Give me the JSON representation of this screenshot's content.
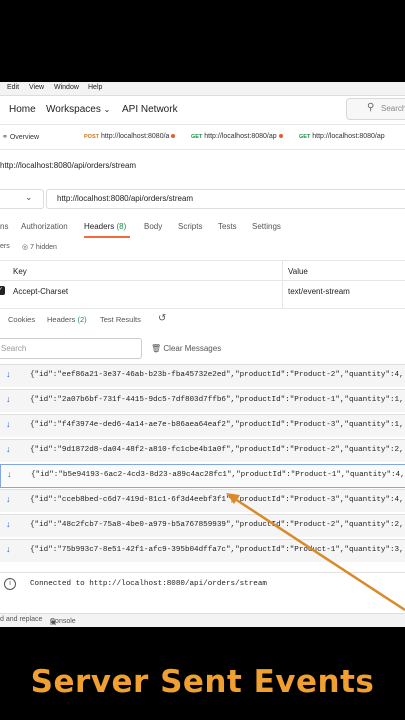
{
  "menubar": {
    "edit": "Edit",
    "view": "View",
    "window": "Window",
    "help": "Help"
  },
  "topnav": {
    "home": "Home",
    "workspaces": "Workspaces",
    "api_network": "API Network",
    "search_placeholder": "Search"
  },
  "tabs": [
    {
      "method": "",
      "label": "Overview"
    },
    {
      "method": "POST",
      "label": "http://localhost:8080/a"
    },
    {
      "method": "GET",
      "label": "http://localhost:8080/ap"
    },
    {
      "method": "GET",
      "label": "http://localhost:8080/ap"
    }
  ],
  "request": {
    "title": "http://localhost:8080/api/orders/stream",
    "url": "http://localhost:8080/api/orders/stream"
  },
  "request_tabs": {
    "params": "ns",
    "authorization": "Authorization",
    "headers": "Headers",
    "headers_count": "(8)",
    "body": "Body",
    "scripts": "Scripts",
    "tests": "Tests",
    "settings": "Settings"
  },
  "headers_section": {
    "label": "ers",
    "hidden": "7 hidden"
  },
  "header_table": {
    "col_key": "Key",
    "col_value": "Value",
    "rows": [
      {
        "key": "Accept-Charset",
        "value": "text/event-stream"
      }
    ]
  },
  "response_tabs": {
    "cookies": "Cookies",
    "headers": "Headers",
    "headers_count": "(2)",
    "test_results": "Test Results"
  },
  "messages_toolbar": {
    "search_placeholder": "Search",
    "clear": "Clear Messages"
  },
  "messages": [
    "{\"id\":\"eef86a21-3e37-46ab-b23b-fba45732e2ed\",\"productId\":\"Product-2\",\"quantity\":4,",
    "{\"id\":\"2a07b6bf-731f-4415-9dc5-7df803d7ffb6\",\"productId\":\"Product-1\",\"quantity\":1,",
    "{\"id\":\"f4f3974e-ded6-4a14-ae7e-b86aea64eaf2\",\"productId\":\"Product-3\",\"quantity\":1,",
    "{\"id\":\"9d1872d8-da04-48f2-a810-fc1cbe4b1a0f\",\"productId\":\"Product-2\",\"quantity\":2,",
    "{\"id\":\"b5e94193-6ac2-4cd3-8d23-a89c4ac28fc1\",\"productId\":\"Product-1\",\"quantity\":4,",
    "{\"id\":\"cceb8bed-c6d7-419d-81c1-6f3d4eebf3f1\",\"productId\":\"Product-3\",\"quantity\":4,",
    "{\"id\":\"48c2fcb7-75a8-4be0-a979-b5a767859939\",\"productId\":\"Product-2\",\"quantity\":2,",
    "{\"id\":\"75b993c7-8e51-42f1-afc9-395b04dffa7c\",\"productId\":\"Product-1\",\"quantity\":3,"
  ],
  "status": {
    "connected": "Connected to http://localhost:8080/api/orders/stream"
  },
  "footer": {
    "find": "d and replace",
    "console": "Console"
  },
  "caption": "Server Sent Events",
  "colors": {
    "accent": "#f26b3a",
    "caption": "#f0a030",
    "arrow": "#d98a2b",
    "get": "#1a8f4b",
    "post": "#c7771b",
    "message_arrow": "#2766d6"
  }
}
